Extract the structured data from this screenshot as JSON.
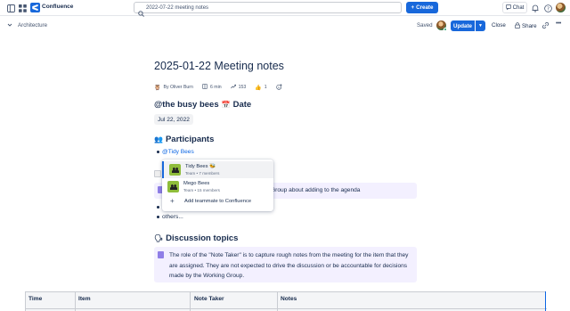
{
  "topbar": {
    "app_name": "Confluence",
    "search_text": "2022-07-22 meeting notes",
    "create_label": "Create",
    "chat_label": "Chat"
  },
  "header": {
    "breadcrumb": "Architecture",
    "saved_label": "Saved",
    "update_label": "Update",
    "close_label": "Close",
    "share_label": "Share"
  },
  "page": {
    "title": "2025-01-22 Meeting notes",
    "byline": {
      "author": "By Oliver Burn",
      "read_time": "6 min",
      "views": "153",
      "likes": "1"
    },
    "date_heading": "@the busy bees",
    "date_heading_suffix": "Date",
    "date_value": "Jul 22, 2022",
    "participants_heading": "Participants",
    "participant_mention": "@Tidy Bees",
    "panel1_text": "Group about adding to the agenda",
    "others": "others...",
    "topics_heading": "Discussion topics",
    "panel2_text": "The role of the \"Note Taker\" is to capture rough notes from the meeting for the item that they are assigned. They are not expected to drive the discussion or be accountable for decisions made by the Working Group."
  },
  "dropdown": {
    "items": [
      {
        "name": "Tidy Bees 🐝",
        "sub": "Team • 7 members",
        "selected": true
      },
      {
        "name": "Mego Bees",
        "sub": "Team • 15 members",
        "selected": false
      }
    ],
    "add_label": "Add teammate to Confluence"
  },
  "table": {
    "headers": [
      "Time",
      "Item",
      "Note Taker",
      "Notes"
    ]
  },
  "colors": {
    "brand": "#1868db",
    "panel_bg": "#f3f0ff",
    "link": "#0c66e4"
  }
}
